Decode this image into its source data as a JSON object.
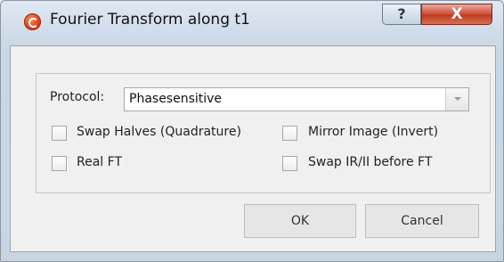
{
  "window": {
    "title": "Fourier Transform along t1",
    "help_label": "?",
    "close_label": "X"
  },
  "form": {
    "protocol_label": "Protocol:",
    "protocol_value": "Phasesensitive",
    "checkboxes": [
      {
        "label": "Swap Halves (Quadrature)",
        "checked": false
      },
      {
        "label": "Mirror Image (Invert)",
        "checked": false
      },
      {
        "label": "Real FT",
        "checked": false
      },
      {
        "label": "Swap IR/II before FT",
        "checked": false
      }
    ]
  },
  "buttons": {
    "ok_label": "OK",
    "cancel_label": "Cancel"
  }
}
